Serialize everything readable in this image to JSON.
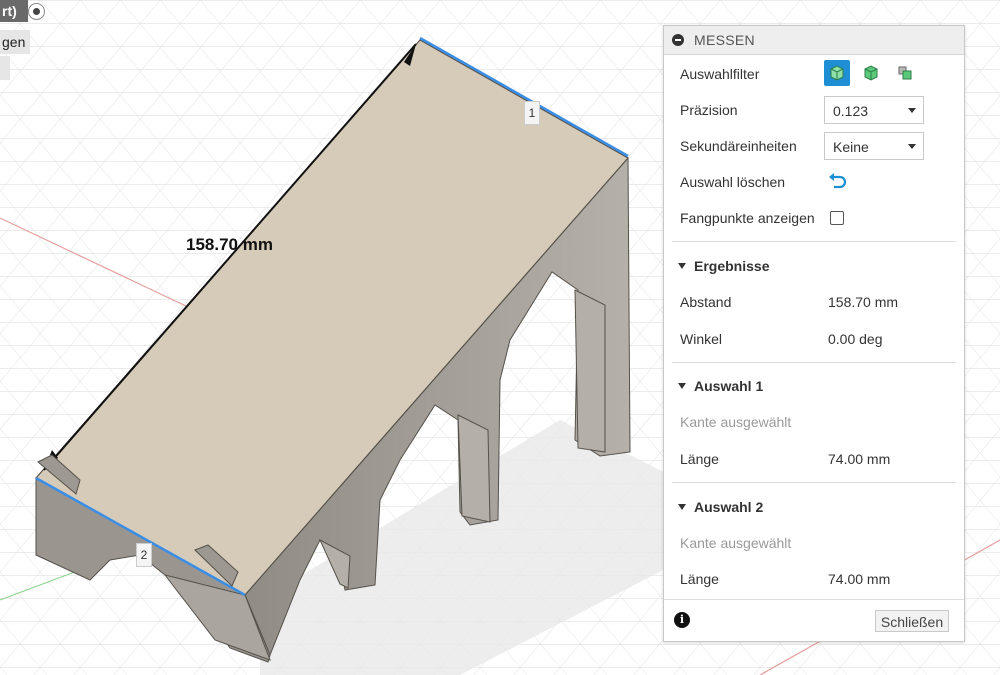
{
  "viewport": {
    "toolbar_fragments": [
      "rt)",
      "gen"
    ],
    "dimension_label": "158.70 mm",
    "edge_markers": [
      "1",
      "2"
    ]
  },
  "panel": {
    "title": "MESSEN",
    "rows": {
      "selection_filter_label": "Auswahlfilter",
      "precision_label": "Präzision",
      "precision_value": "0.123",
      "secondary_units_label": "Sekundäreinheiten",
      "secondary_units_value": "Keine",
      "clear_selection_label": "Auswahl löschen",
      "show_snap_points_label": "Fangpunkte anzeigen"
    },
    "results": {
      "title": "Ergebnisse",
      "distance_label": "Abstand",
      "distance_value": "158.70 mm",
      "angle_label": "Winkel",
      "angle_value": "0.00 deg"
    },
    "selection1": {
      "title": "Auswahl 1",
      "status": "Kante ausgewählt",
      "length_label": "Länge",
      "length_value": "74.00 mm"
    },
    "selection2": {
      "title": "Auswahl 2",
      "status": "Kante ausgewählt",
      "length_label": "Länge",
      "length_value": "74.00 mm"
    },
    "info_icon": "info-icon",
    "close_label": "Schließen"
  },
  "colors": {
    "accent_blue": "#1e8fd4",
    "face_beige": "#d6cbb8",
    "side_grey": "#9d9891",
    "edge_highlight": "#3a8ee6",
    "axis_red": "#e07070",
    "axis_green": "#6cc86c"
  }
}
